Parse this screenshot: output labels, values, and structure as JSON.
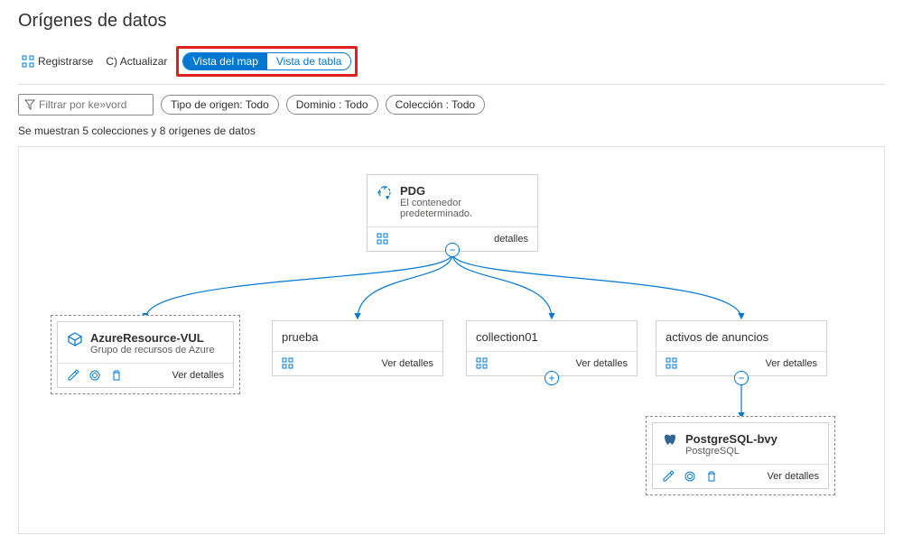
{
  "page": {
    "title": "Orígenes de datos"
  },
  "toolbar": {
    "register_label": "Registrarse",
    "refresh_label": "C) Actualizar",
    "view_map_label": "Vista del map",
    "view_table_label": "Vista de tabla"
  },
  "filters": {
    "keyword_placeholder": "Filtrar por ke»vord",
    "source_type": "Tipo de origen: Todo",
    "domain": "Dominio : Todo",
    "collection": "Colección : Todo"
  },
  "status": {
    "text": "Se muestran 5 colecciones y 8 orígenes de datos"
  },
  "cards": {
    "root": {
      "title": "PDG",
      "subtitle": "El contenedor predeterminado.",
      "details": "detalles"
    },
    "azure_rg": {
      "title": "AzureResource-VUL",
      "subtitle": "Grupo de recursos de Azure",
      "details": "Ver detalles"
    },
    "prueba": {
      "title": "prueba",
      "details": "Ver detalles"
    },
    "collection01": {
      "title": "collection01",
      "details": "Ver detalles"
    },
    "ads_assets": {
      "title": "activos de anuncios",
      "details": "Ver detalles"
    },
    "postgres": {
      "title": "PostgreSQL-bvy",
      "subtitle": "PostgreSQL",
      "details": "Ver detalles"
    }
  },
  "icons": {
    "grid": "grid-icon",
    "filter": "filter-icon",
    "recycle": "recycle-icon",
    "cube": "cube-icon",
    "pencil": "pencil-icon",
    "scan": "scan-icon",
    "trash": "trash-icon",
    "postgres": "postgres-icon"
  },
  "toggles": {
    "minus": "−",
    "plus": "+"
  }
}
